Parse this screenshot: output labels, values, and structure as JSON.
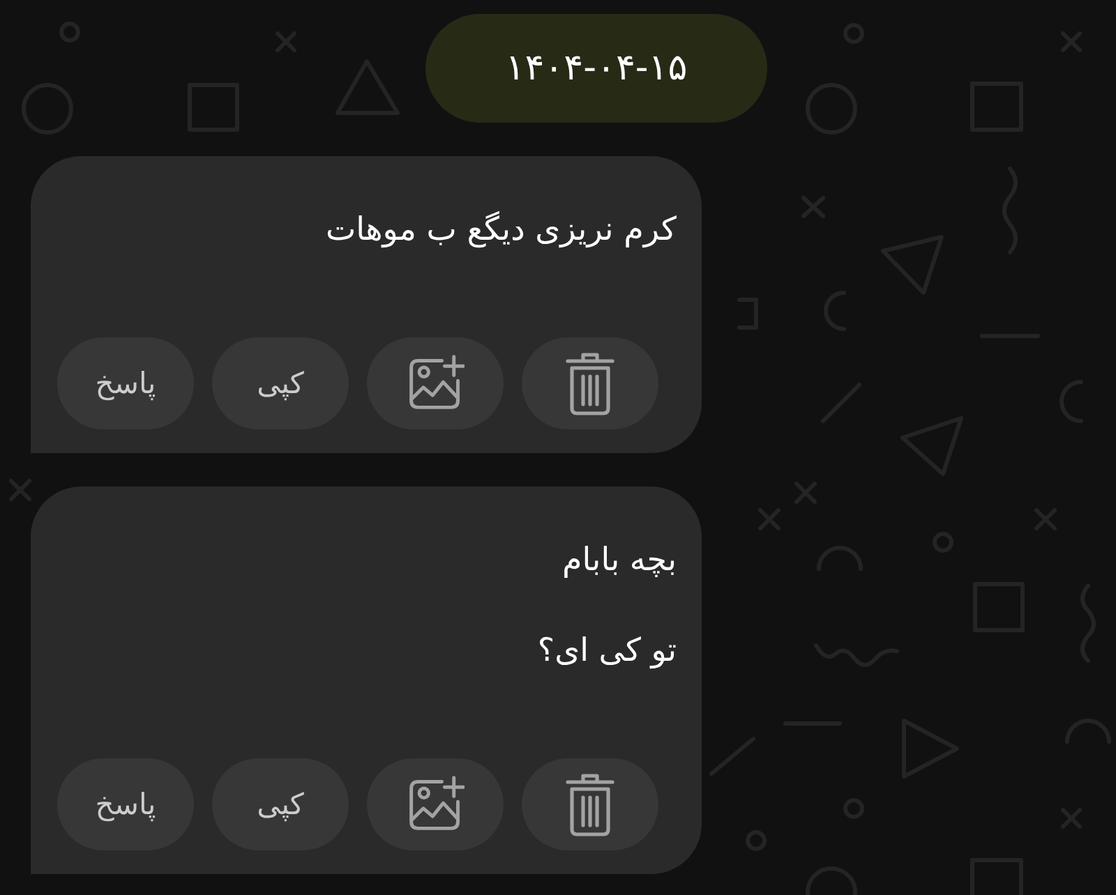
{
  "date_pill": {
    "text": "۱۴۰۴-۰۴-۱۵"
  },
  "messages": [
    {
      "lines": [
        "کرم نریزی دیگع ب موهات"
      ],
      "actions": [
        {
          "kind": "delete"
        },
        {
          "kind": "add-image"
        },
        {
          "kind": "copy",
          "label": "کپی"
        },
        {
          "kind": "reply",
          "label": "پاسخ"
        }
      ]
    },
    {
      "lines": [
        "بچه بابام",
        "تو کی ای؟"
      ],
      "actions": [
        {
          "kind": "delete"
        },
        {
          "kind": "add-image"
        },
        {
          "kind": "copy",
          "label": "کپی"
        },
        {
          "kind": "reply",
          "label": "پاسخ"
        }
      ]
    }
  ]
}
